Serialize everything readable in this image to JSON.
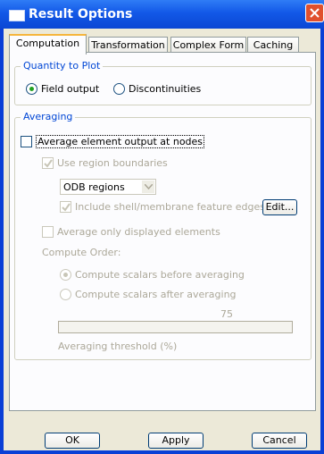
{
  "window": {
    "title": "Result Options",
    "icon": "window-icon"
  },
  "tabs": [
    "Computation",
    "Transformation",
    "Complex Form",
    "Caching"
  ],
  "quantity": {
    "legend": "Quantity to Plot",
    "options": [
      "Field output",
      "Discontinuities"
    ],
    "selected": "Field output"
  },
  "averaging": {
    "legend": "Averaging",
    "average_nodes_label": "Average element output at nodes",
    "average_nodes_checked": false,
    "use_region_boundaries_label": "Use region boundaries",
    "use_region_boundaries_checked": true,
    "region_type": "ODB regions",
    "include_edges_label": "Include shell/membrane feature edges",
    "include_edges_checked": true,
    "edit_button": "Edit...",
    "displayed_only_label": "Average only displayed elements",
    "displayed_only_checked": false,
    "compute_order_label": "Compute Order:",
    "compute_options": [
      "Compute scalars before averaging",
      "Compute scalars after averaging"
    ],
    "compute_selected": "Compute scalars before averaging",
    "threshold_value": "75",
    "threshold_label": "Averaging threshold (%)"
  },
  "buttons": {
    "ok": "OK",
    "apply": "Apply",
    "cancel": "Cancel"
  }
}
